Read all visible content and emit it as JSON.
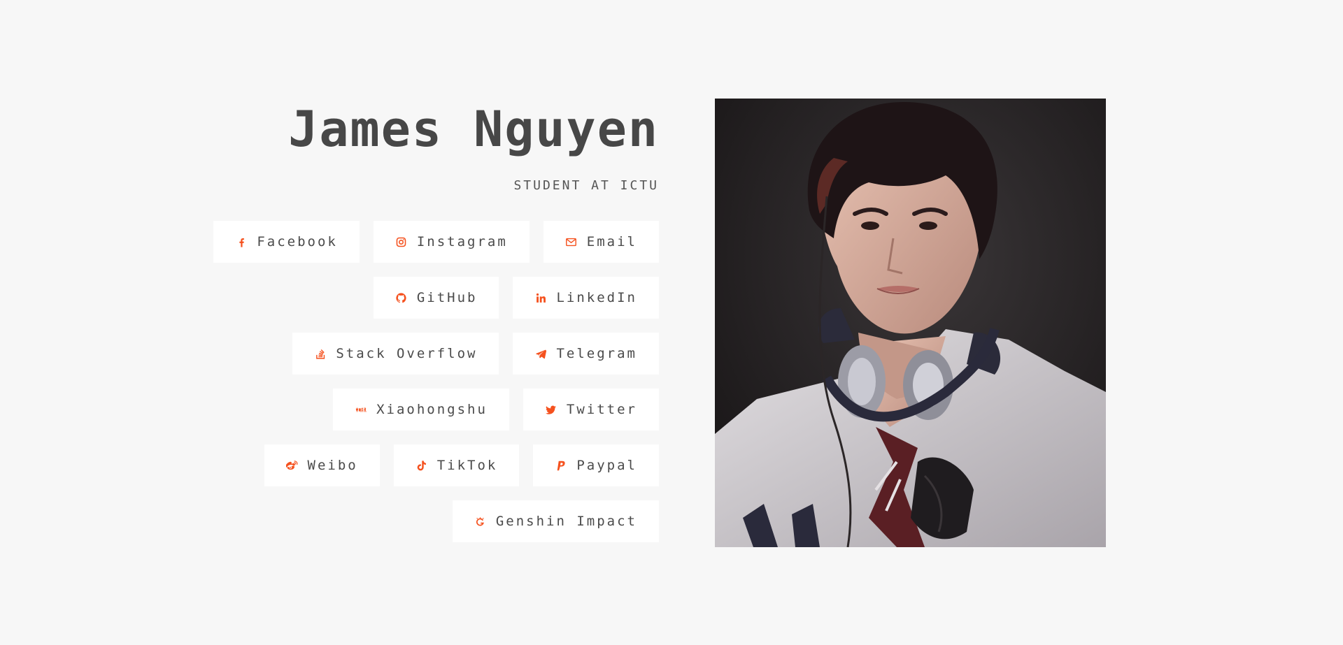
{
  "profile": {
    "name": "James Nguyen",
    "subtitle": "STUDENT AT ICTU"
  },
  "accent_color": "#f5511e",
  "links": {
    "facebook": {
      "label": "Facebook",
      "icon": "facebook-icon"
    },
    "instagram": {
      "label": "Instagram",
      "icon": "instagram-icon"
    },
    "email": {
      "label": "Email",
      "icon": "envelope-icon"
    },
    "github": {
      "label": "GitHub",
      "icon": "github-icon"
    },
    "linkedin": {
      "label": "LinkedIn",
      "icon": "linkedin-icon"
    },
    "stackoverflow": {
      "label": "Stack Overflow",
      "icon": "stack-overflow-icon"
    },
    "telegram": {
      "label": "Telegram",
      "icon": "telegram-icon"
    },
    "xiaohongshu": {
      "label": "Xiaohongshu",
      "icon": "xiaohongshu-icon"
    },
    "twitter": {
      "label": "Twitter",
      "icon": "twitter-icon"
    },
    "weibo": {
      "label": "Weibo",
      "icon": "weibo-icon"
    },
    "tiktok": {
      "label": "TikTok",
      "icon": "tiktok-icon"
    },
    "paypal": {
      "label": "Paypal",
      "icon": "paypal-icon"
    },
    "genshin": {
      "label": "Genshin Impact",
      "icon": "genshin-icon"
    }
  },
  "photo": {
    "icon": "profile-photo"
  }
}
